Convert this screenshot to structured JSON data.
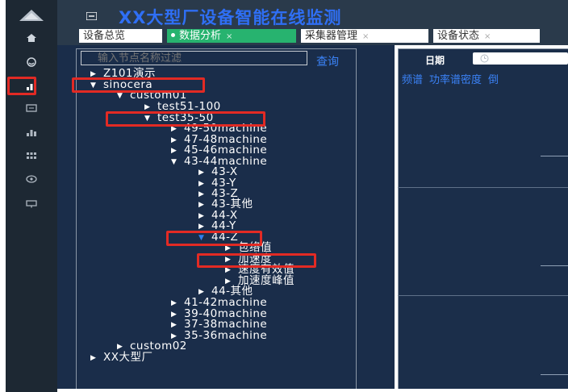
{
  "app": {
    "title": "XX大型厂设备智能在线监测"
  },
  "sidebar": {
    "items": [
      {
        "icon": "home-icon"
      },
      {
        "icon": "dashboard-icon"
      },
      {
        "icon": "bar-chart-icon",
        "active": true
      },
      {
        "icon": "device-icon"
      },
      {
        "icon": "bar-chart-icon"
      },
      {
        "icon": "grid-icon"
      },
      {
        "icon": "eye-icon"
      },
      {
        "icon": "screen-icon"
      }
    ]
  },
  "tabs": [
    {
      "label": "设备总览",
      "active": false,
      "closable": false
    },
    {
      "label": "数据分析",
      "active": true,
      "closable": true
    },
    {
      "label": "采集器管理",
      "active": false,
      "closable": true
    },
    {
      "label": "设备状态",
      "active": false,
      "closable": true
    }
  ],
  "tab_close_glyph": "×",
  "tree_panel": {
    "filter_placeholder": "输入节点名称过滤",
    "query_label": "查询",
    "nodes": [
      {
        "label": "Z101演示",
        "expanded": false
      },
      {
        "label": "sinocera",
        "expanded": true,
        "highlighted": true
      },
      {
        "label": "custom01",
        "expanded": true
      },
      {
        "label": "test51-100",
        "expanded": false
      },
      {
        "label": "test35-50",
        "expanded": true,
        "highlighted": true
      },
      {
        "label": "49-50machine",
        "expanded": false
      },
      {
        "label": "47-48machine",
        "expanded": false
      },
      {
        "label": "45-46machine",
        "expanded": false
      },
      {
        "label": "43-44machine",
        "expanded": true
      },
      {
        "label": "43-X",
        "expanded": false
      },
      {
        "label": "43-Y",
        "expanded": false
      },
      {
        "label": "43-Z",
        "expanded": false
      },
      {
        "label": "43-其他",
        "expanded": false
      },
      {
        "label": "44-X",
        "expanded": false
      },
      {
        "label": "44-Y",
        "expanded": false
      },
      {
        "label": "44-Z",
        "expanded": true,
        "highlighted": true
      },
      {
        "label": "包络值",
        "expanded": false
      },
      {
        "label": "加速度",
        "expanded": false,
        "highlighted": true
      },
      {
        "label": "速度有效值",
        "expanded": false
      },
      {
        "label": "加速度峰值",
        "expanded": false
      },
      {
        "label": "44-其他",
        "expanded": false
      },
      {
        "label": "41-42machine",
        "expanded": false
      },
      {
        "label": "39-40machine",
        "expanded": false
      },
      {
        "label": "37-38machine",
        "expanded": false
      },
      {
        "label": "35-36machine",
        "expanded": false
      },
      {
        "label": "custom02",
        "expanded": false
      },
      {
        "label": "XX大型厂",
        "expanded": false
      }
    ]
  },
  "analysis_panel": {
    "date_label": "日期",
    "tabs": [
      "频谱",
      "功率谱密度",
      "倒"
    ]
  },
  "colors": {
    "rail_bg": "#1d2833",
    "header_bg": "#2a3a4b",
    "title_blue": "#2f6ff5",
    "panel_bg": "#1a2d4a",
    "tab_active": "#27b36f",
    "link_blue": "#3b82f6",
    "highlight_red": "#e22a24"
  }
}
